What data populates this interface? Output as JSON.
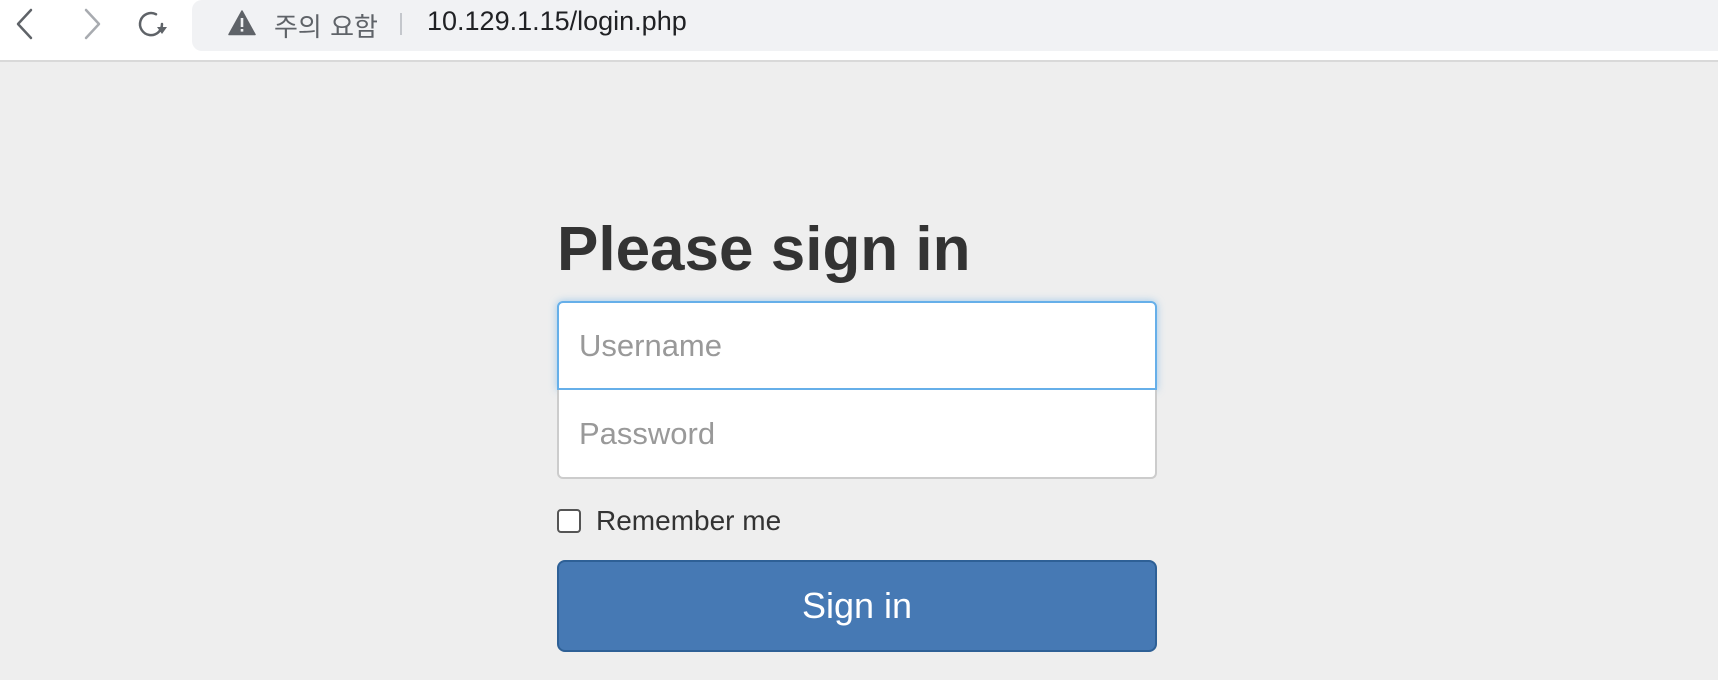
{
  "browser": {
    "security_warning": "주의 요함",
    "url": "10.129.1.15/login.php"
  },
  "form": {
    "heading": "Please sign in",
    "username_placeholder": "Username",
    "password_placeholder": "Password",
    "remember_label": "Remember me",
    "remember_checked": false,
    "submit_label": "Sign in"
  },
  "colors": {
    "page_bg": "#eeeeee",
    "button_bg": "#4679b4",
    "focus_border": "#66afe9",
    "heading_text": "#333333"
  }
}
